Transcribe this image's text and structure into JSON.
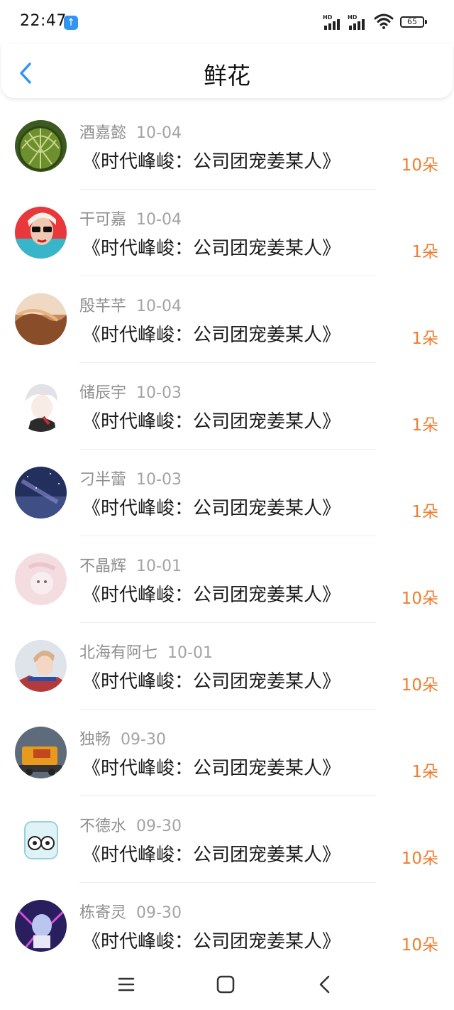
{
  "status_bar": {
    "time": "22:47",
    "upload_badge": "↑",
    "sim1_label": "HD",
    "sim2_label": "HD",
    "battery_level": "65"
  },
  "header": {
    "title": "鲜花",
    "back_icon": "chevron-left-icon"
  },
  "colors": {
    "accent_blue": "#2f95f0",
    "count_orange": "#ef7c2e"
  },
  "gifts": [
    {
      "name": "酒嘉懿",
      "date": "10-04",
      "book": "《时代峰峻：公司团宠姜某人》",
      "count": "10朵"
    },
    {
      "name": "干可嘉",
      "date": "10-04",
      "book": "《时代峰峻：公司团宠姜某人》",
      "count": "1朵"
    },
    {
      "name": "殷芊芊",
      "date": "10-04",
      "book": "《时代峰峻：公司团宠姜某人》",
      "count": "1朵"
    },
    {
      "name": "储辰宇",
      "date": "10-03",
      "book": "《时代峰峻：公司团宠姜某人》",
      "count": "1朵"
    },
    {
      "name": "刁半蕾",
      "date": "10-03",
      "book": "《时代峰峻：公司团宠姜某人》",
      "count": "1朵"
    },
    {
      "name": "不晶辉",
      "date": "10-01",
      "book": "《时代峰峻：公司团宠姜某人》",
      "count": "10朵"
    },
    {
      "name": "北海有阿七",
      "date": "10-01",
      "book": "《时代峰峻：公司团宠姜某人》",
      "count": "10朵"
    },
    {
      "name": "独畅",
      "date": "09-30",
      "book": "《时代峰峻：公司团宠姜某人》",
      "count": "1朵"
    },
    {
      "name": "不德水",
      "date": "09-30",
      "book": "《时代峰峻：公司团宠姜某人》",
      "count": "10朵"
    },
    {
      "name": "栋寄灵",
      "date": "09-30",
      "book": "《时代峰峻：公司团宠姜某人》",
      "count": "10朵"
    }
  ],
  "nav_bar": {
    "menu_icon": "menu-icon",
    "home_icon": "home-square-icon",
    "back_icon": "back-triangle-icon"
  }
}
